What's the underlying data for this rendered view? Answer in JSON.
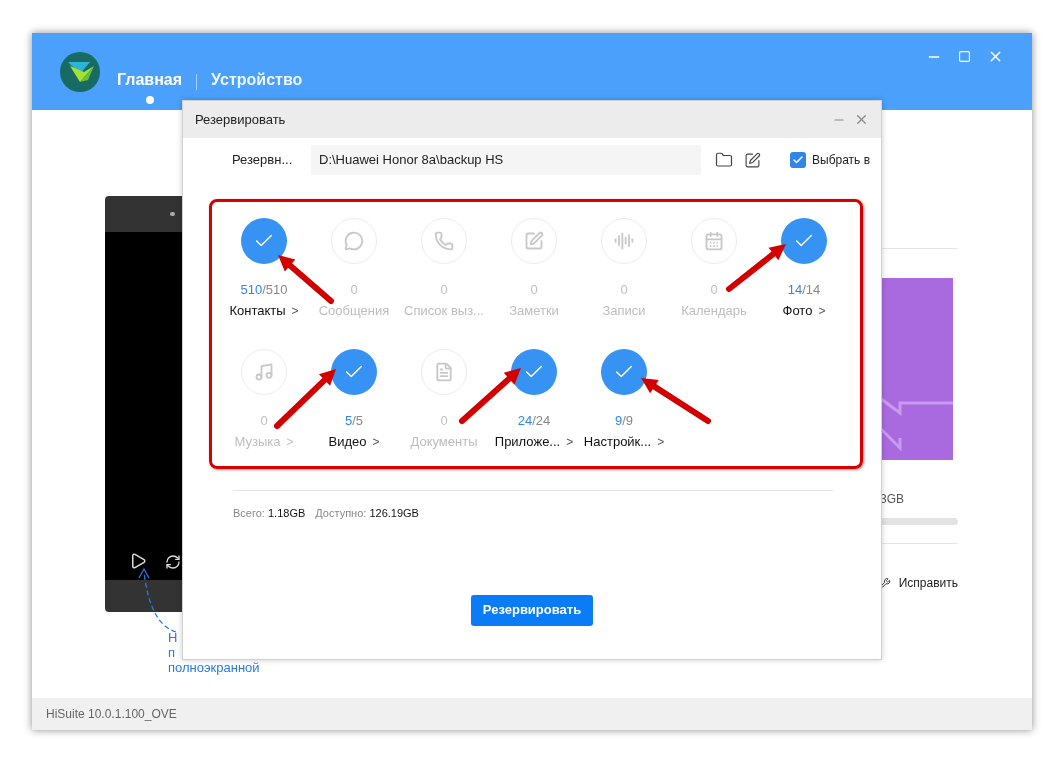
{
  "header": {
    "tabs": [
      {
        "label": "Главная",
        "selected": true
      },
      {
        "label": "Устройство",
        "selected": false
      }
    ]
  },
  "device_preview": {
    "hint_lines": [
      "Н",
      "п",
      "полноэкранной"
    ]
  },
  "side_panel": {
    "storage_text": "3GB",
    "action": "Исправить"
  },
  "dialog": {
    "title": "Резервировать",
    "path_label": "Резервн...",
    "path": "D:\\Huawei Honor 8a\\backup HS",
    "select_all": {
      "label": "Выбрать в",
      "checked": true
    },
    "items": [
      {
        "kind": "contacts",
        "label": "Контакты",
        "count": "510",
        "total": "/510",
        "arrow": ">",
        "selected": true
      },
      {
        "kind": "messages",
        "label": "Сообщения",
        "count": "0",
        "selected": false
      },
      {
        "kind": "calls",
        "label": "Список выз...",
        "count": "0",
        "selected": false
      },
      {
        "kind": "notes",
        "label": "Заметки",
        "count": "0",
        "selected": false
      },
      {
        "kind": "recordings",
        "label": "Записи",
        "count": "0",
        "selected": false
      },
      {
        "kind": "calendar",
        "label": "Календарь",
        "count": "0",
        "selected": false
      },
      {
        "kind": "photos",
        "label": "Фото",
        "count": "14",
        "total": "/14",
        "arrow": ">",
        "selected": true
      },
      {
        "kind": "music",
        "label": "Музыка",
        "count": "0",
        "arrow": ">",
        "selected": false
      },
      {
        "kind": "video",
        "label": "Видео",
        "count": "5",
        "total": "/5",
        "arrow": ">",
        "selected": true
      },
      {
        "kind": "documents",
        "label": "Документы",
        "count": "0",
        "selected": false
      },
      {
        "kind": "apps",
        "label": "Приложе...",
        "count": "24",
        "total": "/24",
        "arrow": ">",
        "selected": true
      },
      {
        "kind": "settings",
        "label": "Настройк...",
        "count": "9",
        "total": "/9",
        "arrow": ">",
        "selected": true
      }
    ],
    "summary": [
      {
        "label": "Всего:",
        "value": "1.18GB"
      },
      {
        "label": "Доступно:",
        "value": "126.19GB"
      }
    ],
    "button": "Резервировать"
  },
  "status_bar": "HiSuite 10.0.1.100_OVE"
}
